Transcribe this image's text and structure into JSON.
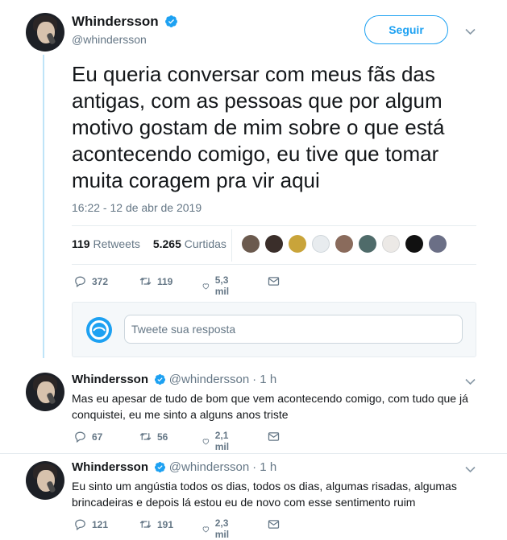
{
  "main_tweet": {
    "author_name": "Whindersson",
    "author_handle": "@whindersson",
    "follow_label": "Seguir",
    "text": "Eu queria conversar com meus fãs das antigas, com as pessoas que por algum motivo gostam de mim sobre o que está acontecendo comigo, eu tive que tomar muita coragem pra vir aqui",
    "timestamp": "16:22 - 12 de abr de 2019",
    "retweets_count": "119",
    "retweets_label": "Retweets",
    "likes_count": "5.265",
    "likes_label": "Curtidas",
    "replies": "372",
    "retweets": "119",
    "likes": "5,3 mil"
  },
  "reply_box": {
    "placeholder": "Tweete sua resposta"
  },
  "thread": [
    {
      "author_name": "Whindersson",
      "author_handle": "@whindersson",
      "time": "· 1 h",
      "text": "Mas eu apesar de tudo de bom que vem acontecendo comigo, com tudo que já conquistei, eu me sinto a alguns anos triste",
      "replies": "67",
      "retweets": "56",
      "likes": "2,1 mil"
    },
    {
      "author_name": "Whindersson",
      "author_handle": "@whindersson",
      "time": "· 1 h",
      "text": "Eu sinto um angústia todos os dias, todos os dias, algumas risadas, algumas brincadeiras e depois lá estou eu de novo com esse sentimento ruim",
      "replies": "121",
      "retweets": "191",
      "likes": "2,3 mil"
    }
  ],
  "colors": {
    "accent": "#1da1f2",
    "text": "#14171a",
    "muted": "#657786",
    "thread_line": "#bfe4f8"
  },
  "icons": [
    "verified-badge-icon",
    "chevron-down-icon",
    "reply-icon",
    "retweet-icon",
    "like-icon",
    "message-icon"
  ]
}
